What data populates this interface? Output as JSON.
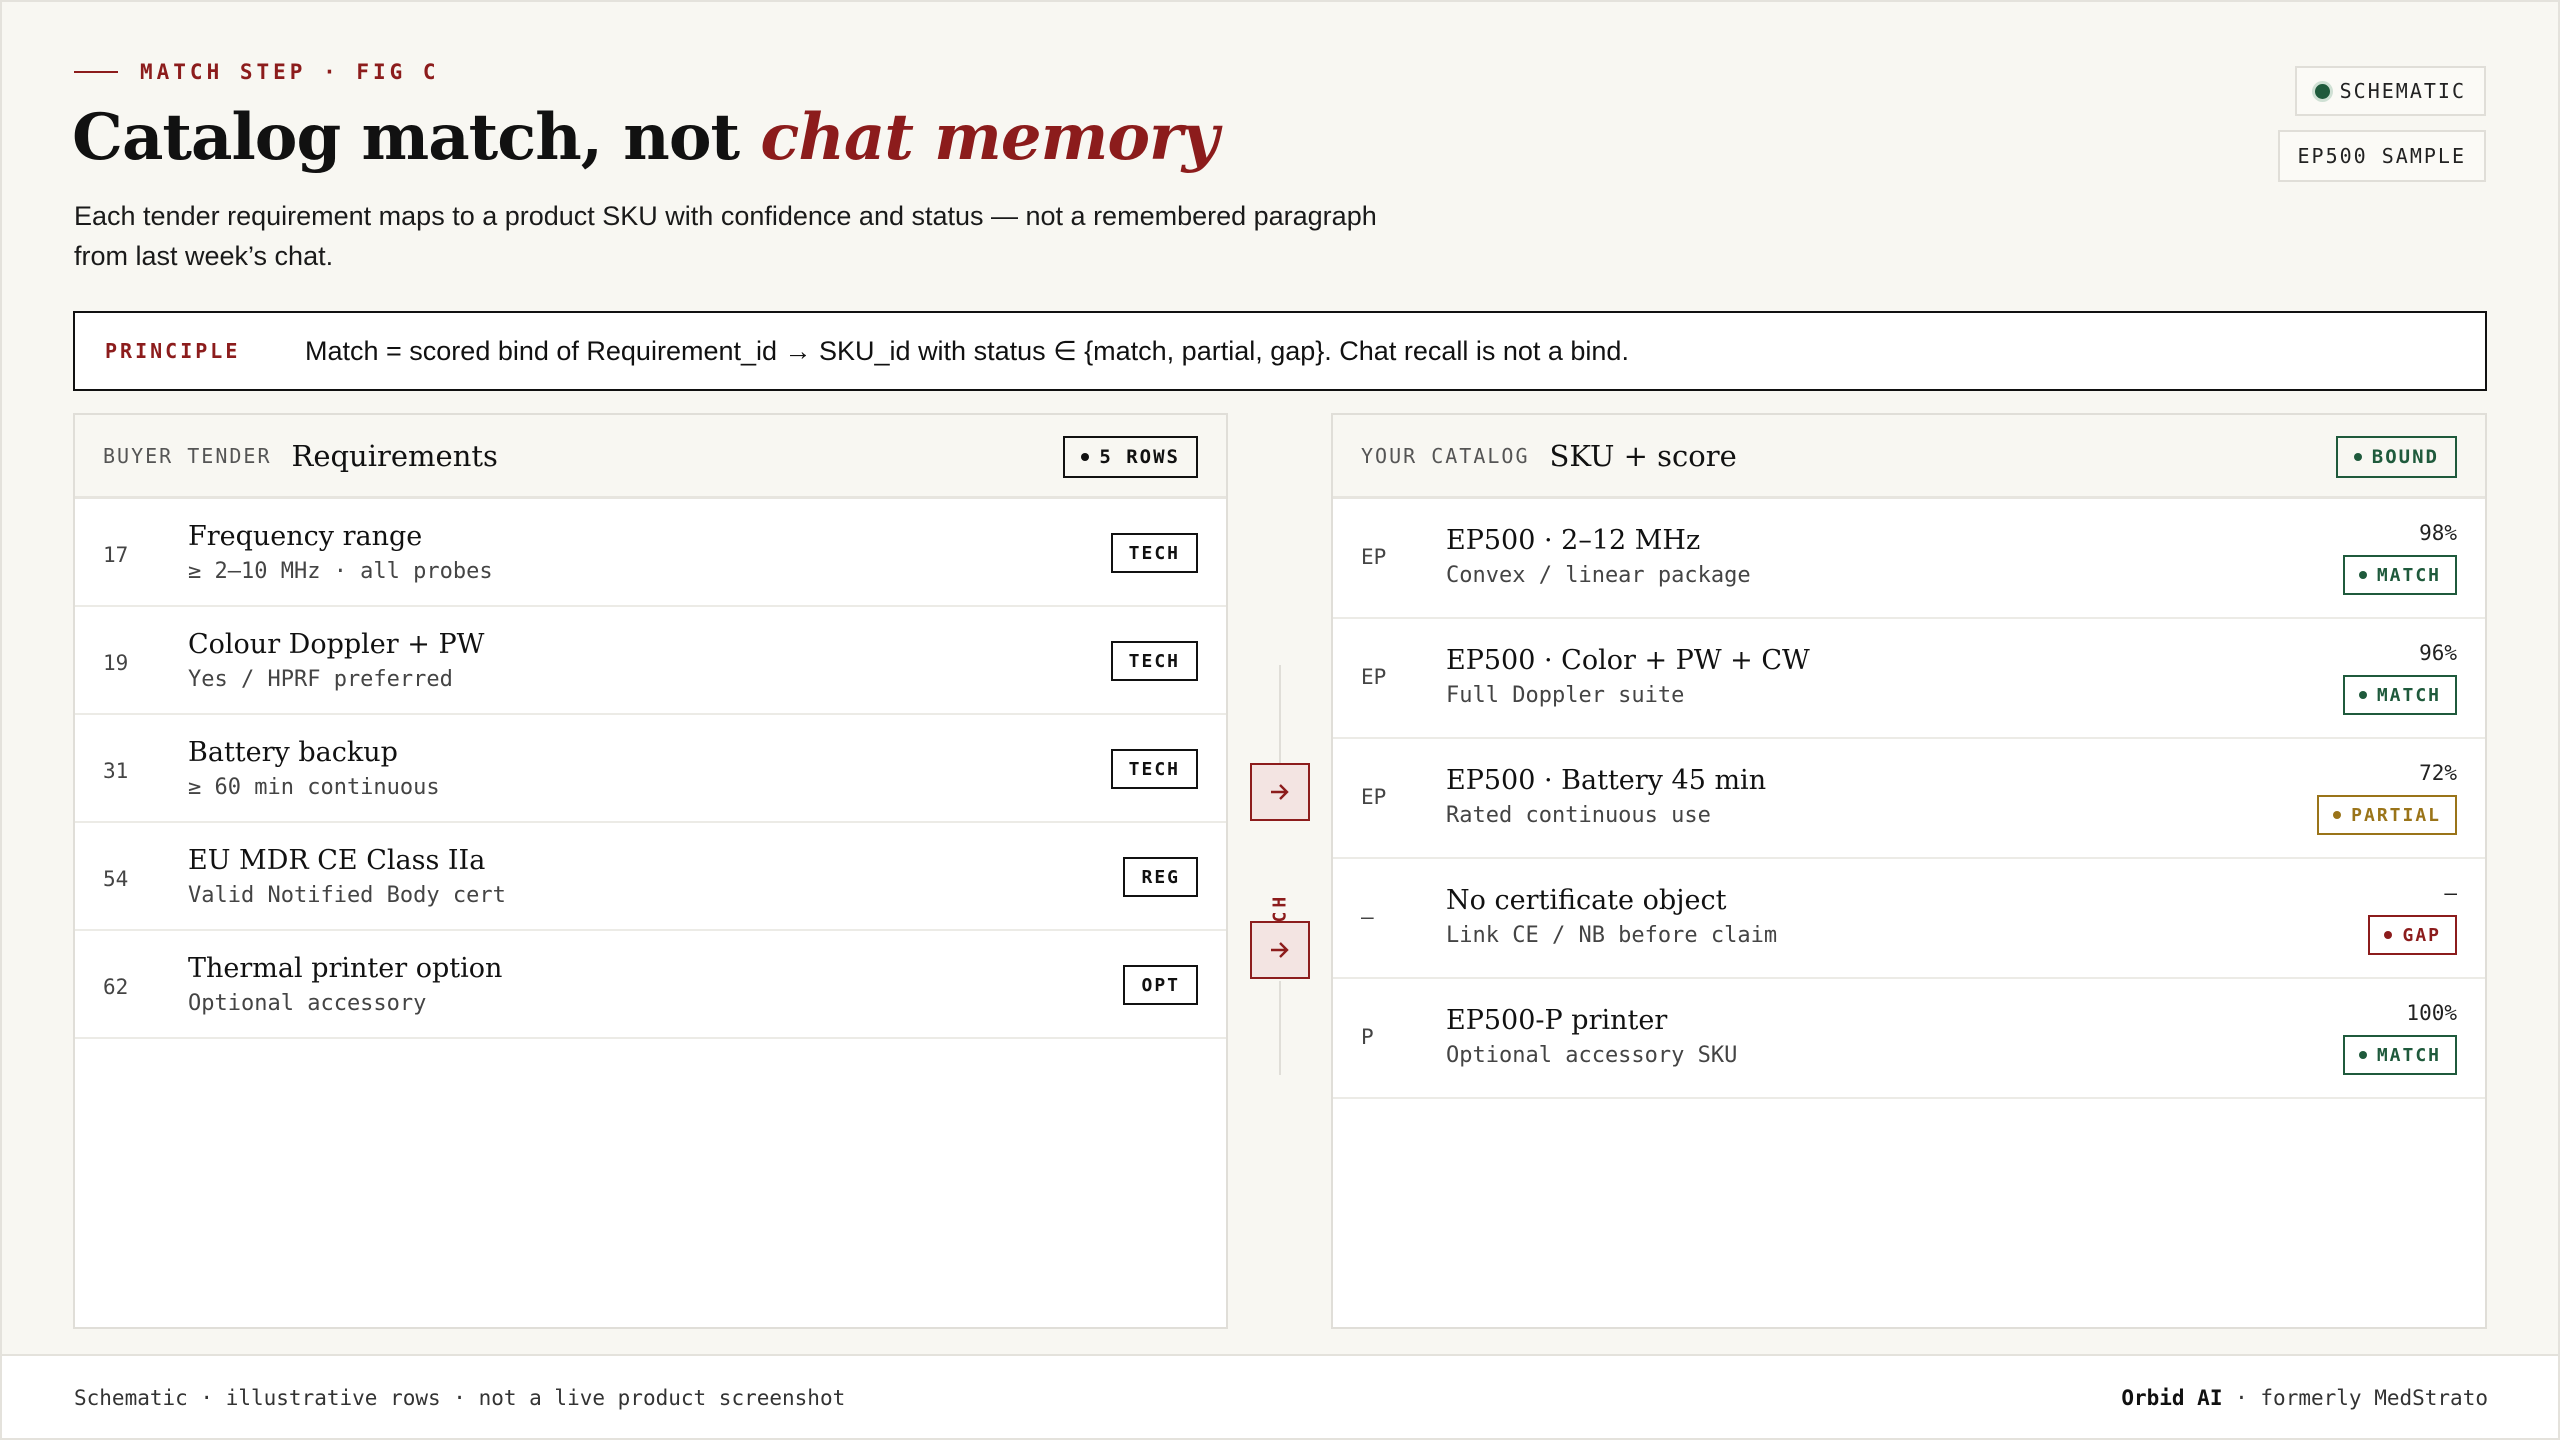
{
  "header": {
    "eyebrow": "MATCH STEP · FIG C",
    "title_main": "Catalog match, not ",
    "title_accent": "chat memory",
    "subtitle": "Each tender requirement maps to a product SKU with confidence and status — not a remembered paragraph from last week’s chat.",
    "tag_schematic": "SCHEMATIC",
    "tag_sample": "EP500 SAMPLE"
  },
  "principle": {
    "label": "PRINCIPLE",
    "text": "Match = scored bind of Requirement_id → SKU_id with status ∈ {match, partial, gap}. Chat recall is not a bind."
  },
  "left_panel": {
    "kicker": "BUYER TENDER",
    "heading": "Requirements",
    "badge": "5 ROWS",
    "rows": [
      {
        "num": "17",
        "name": "Frequency range",
        "desc": "≥ 2–10 MHz · all probes",
        "chip": "TECH"
      },
      {
        "num": "19",
        "name": "Colour Doppler + PW",
        "desc": "Yes / HPRF preferred",
        "chip": "TECH"
      },
      {
        "num": "31",
        "name": "Battery backup",
        "desc": "≥ 60 min continuous",
        "chip": "TECH"
      },
      {
        "num": "54",
        "name": "EU MDR CE Class IIa",
        "desc": "Valid Notified Body cert",
        "chip": "REG"
      },
      {
        "num": "62",
        "name": "Thermal printer option",
        "desc": "Optional accessory",
        "chip": "OPT"
      }
    ]
  },
  "connector": {
    "label": "MATCH"
  },
  "right_panel": {
    "kicker": "YOUR CATALOG",
    "heading": "SKU + score",
    "badge": "BOUND",
    "rows": [
      {
        "code": "EP",
        "name": "EP500 · 2–12 MHz",
        "desc": "Convex / linear package",
        "score": "98%",
        "status": "MATCH"
      },
      {
        "code": "EP",
        "name": "EP500 · Color + PW + CW",
        "desc": "Full Doppler suite",
        "score": "96%",
        "status": "MATCH"
      },
      {
        "code": "EP",
        "name": "EP500 · Battery 45 min",
        "desc": "Rated continuous use",
        "score": "72%",
        "status": "PARTIAL"
      },
      {
        "code": "—",
        "name": "No certificate object",
        "desc": "Link CE / NB before claim",
        "score": "—",
        "status": "GAP"
      },
      {
        "code": "P",
        "name": "EP500-P printer",
        "desc": "Optional accessory SKU",
        "score": "100%",
        "status": "MATCH"
      }
    ]
  },
  "footer": {
    "left": "Schematic · illustrative rows · not a live product screenshot",
    "brand": "Orbid AI",
    "right_suffix": " · formerly MedStrato"
  },
  "colors": {
    "accent": "#8c1c1c",
    "match": "#1f5a3c",
    "partial": "#9a7419",
    "gap": "#8c1c1c",
    "background": "#f8f7f2"
  },
  "icons": {
    "arrow": "arrow-right-icon",
    "status_dot": "dot-icon"
  }
}
